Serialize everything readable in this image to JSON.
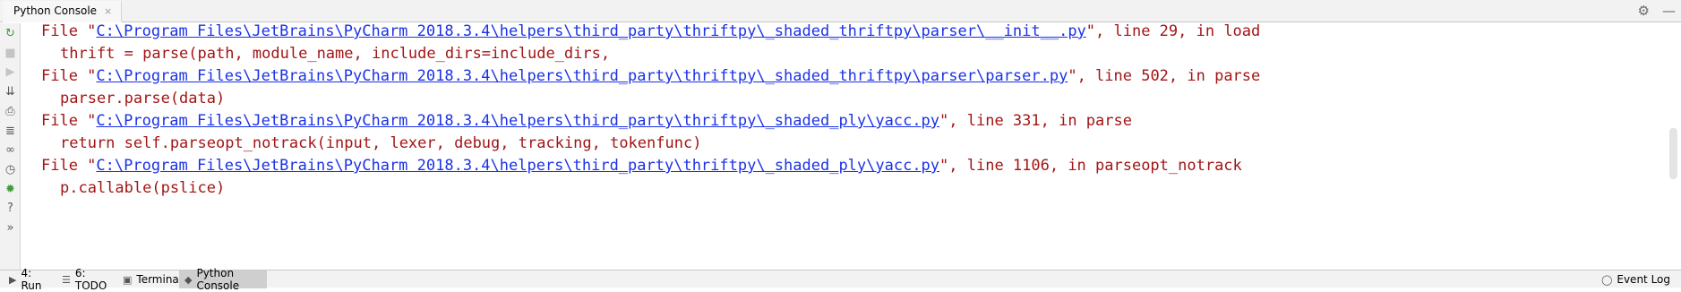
{
  "top_tab": {
    "label": "Python Console",
    "close": "×"
  },
  "top_actions": {
    "settings": "⚙",
    "minimize": "—"
  },
  "left_tools": [
    {
      "name": "rerun-icon",
      "glyph": "↻",
      "color": "#3e9a3e"
    },
    {
      "name": "stop-icon",
      "glyph": "■",
      "color": "#c4c4c4"
    },
    {
      "name": "run-icon",
      "glyph": "▶",
      "color": "#c4c4c4"
    },
    {
      "name": "scroll-end-icon",
      "glyph": "⇊",
      "color": "#5a5a5a"
    },
    {
      "name": "print-icon",
      "glyph": "⎙",
      "color": "#5a5a5a"
    },
    {
      "name": "soft-wrap-icon",
      "glyph": "≣",
      "color": "#5a5a5a"
    },
    {
      "name": "variables-icon",
      "glyph": "∞",
      "color": "#5a5a5a"
    },
    {
      "name": "history-icon",
      "glyph": "◷",
      "color": "#5a5a5a"
    },
    {
      "name": "debug-icon",
      "glyph": "✹",
      "color": "#3e9a3e"
    },
    {
      "name": "help-icon",
      "glyph": "?",
      "color": "#5a5a5a"
    },
    {
      "name": "more-icon",
      "glyph": "»",
      "color": "#5a5a5a"
    }
  ],
  "console_lines": [
    {
      "type": "file",
      "prefix": "File \"",
      "path": "C:\\Program Files\\JetBrains\\PyCharm 2018.3.4\\helpers\\third_party\\thriftpy\\_shaded_thriftpy\\parser\\__init__.py",
      "suffix": "\", line 29, in load"
    },
    {
      "type": "code",
      "text": "thrift = parse(path, module_name, include_dirs=include_dirs,"
    },
    {
      "type": "file",
      "prefix": "File \"",
      "path": "C:\\Program Files\\JetBrains\\PyCharm 2018.3.4\\helpers\\third_party\\thriftpy\\_shaded_thriftpy\\parser\\parser.py",
      "suffix": "\", line 502, in parse"
    },
    {
      "type": "code",
      "text": "parser.parse(data)"
    },
    {
      "type": "file",
      "prefix": "File \"",
      "path": "C:\\Program Files\\JetBrains\\PyCharm 2018.3.4\\helpers\\third_party\\thriftpy\\_shaded_ply\\yacc.py",
      "suffix": "\", line 331, in parse"
    },
    {
      "type": "code",
      "text": "return self.parseopt_notrack(input, lexer, debug, tracking, tokenfunc)"
    },
    {
      "type": "file",
      "prefix": "File \"",
      "path": "C:\\Program Files\\JetBrains\\PyCharm 2018.3.4\\helpers\\third_party\\thriftpy\\_shaded_ply\\yacc.py",
      "suffix": "\", line 1106, in parseopt_notrack"
    },
    {
      "type": "code",
      "text": "p.callable(pslice)"
    }
  ],
  "bottom_tabs": [
    {
      "name": "tool-window-run",
      "icon": "▶",
      "label": "4: Run",
      "active": false
    },
    {
      "name": "tool-window-todo",
      "icon": "☰",
      "label": "6: TODO",
      "active": false
    },
    {
      "name": "tool-window-terminal",
      "icon": "▣",
      "label": "Terminal",
      "active": false
    },
    {
      "name": "tool-window-python-console",
      "icon": "◆",
      "label": "Python Console",
      "active": true
    }
  ],
  "event_log": {
    "icon": "◯",
    "label": "Event Log"
  },
  "colors": {
    "error_text": "#a31515",
    "link": "#1a32e6",
    "accent_green": "#3e9a3e"
  }
}
